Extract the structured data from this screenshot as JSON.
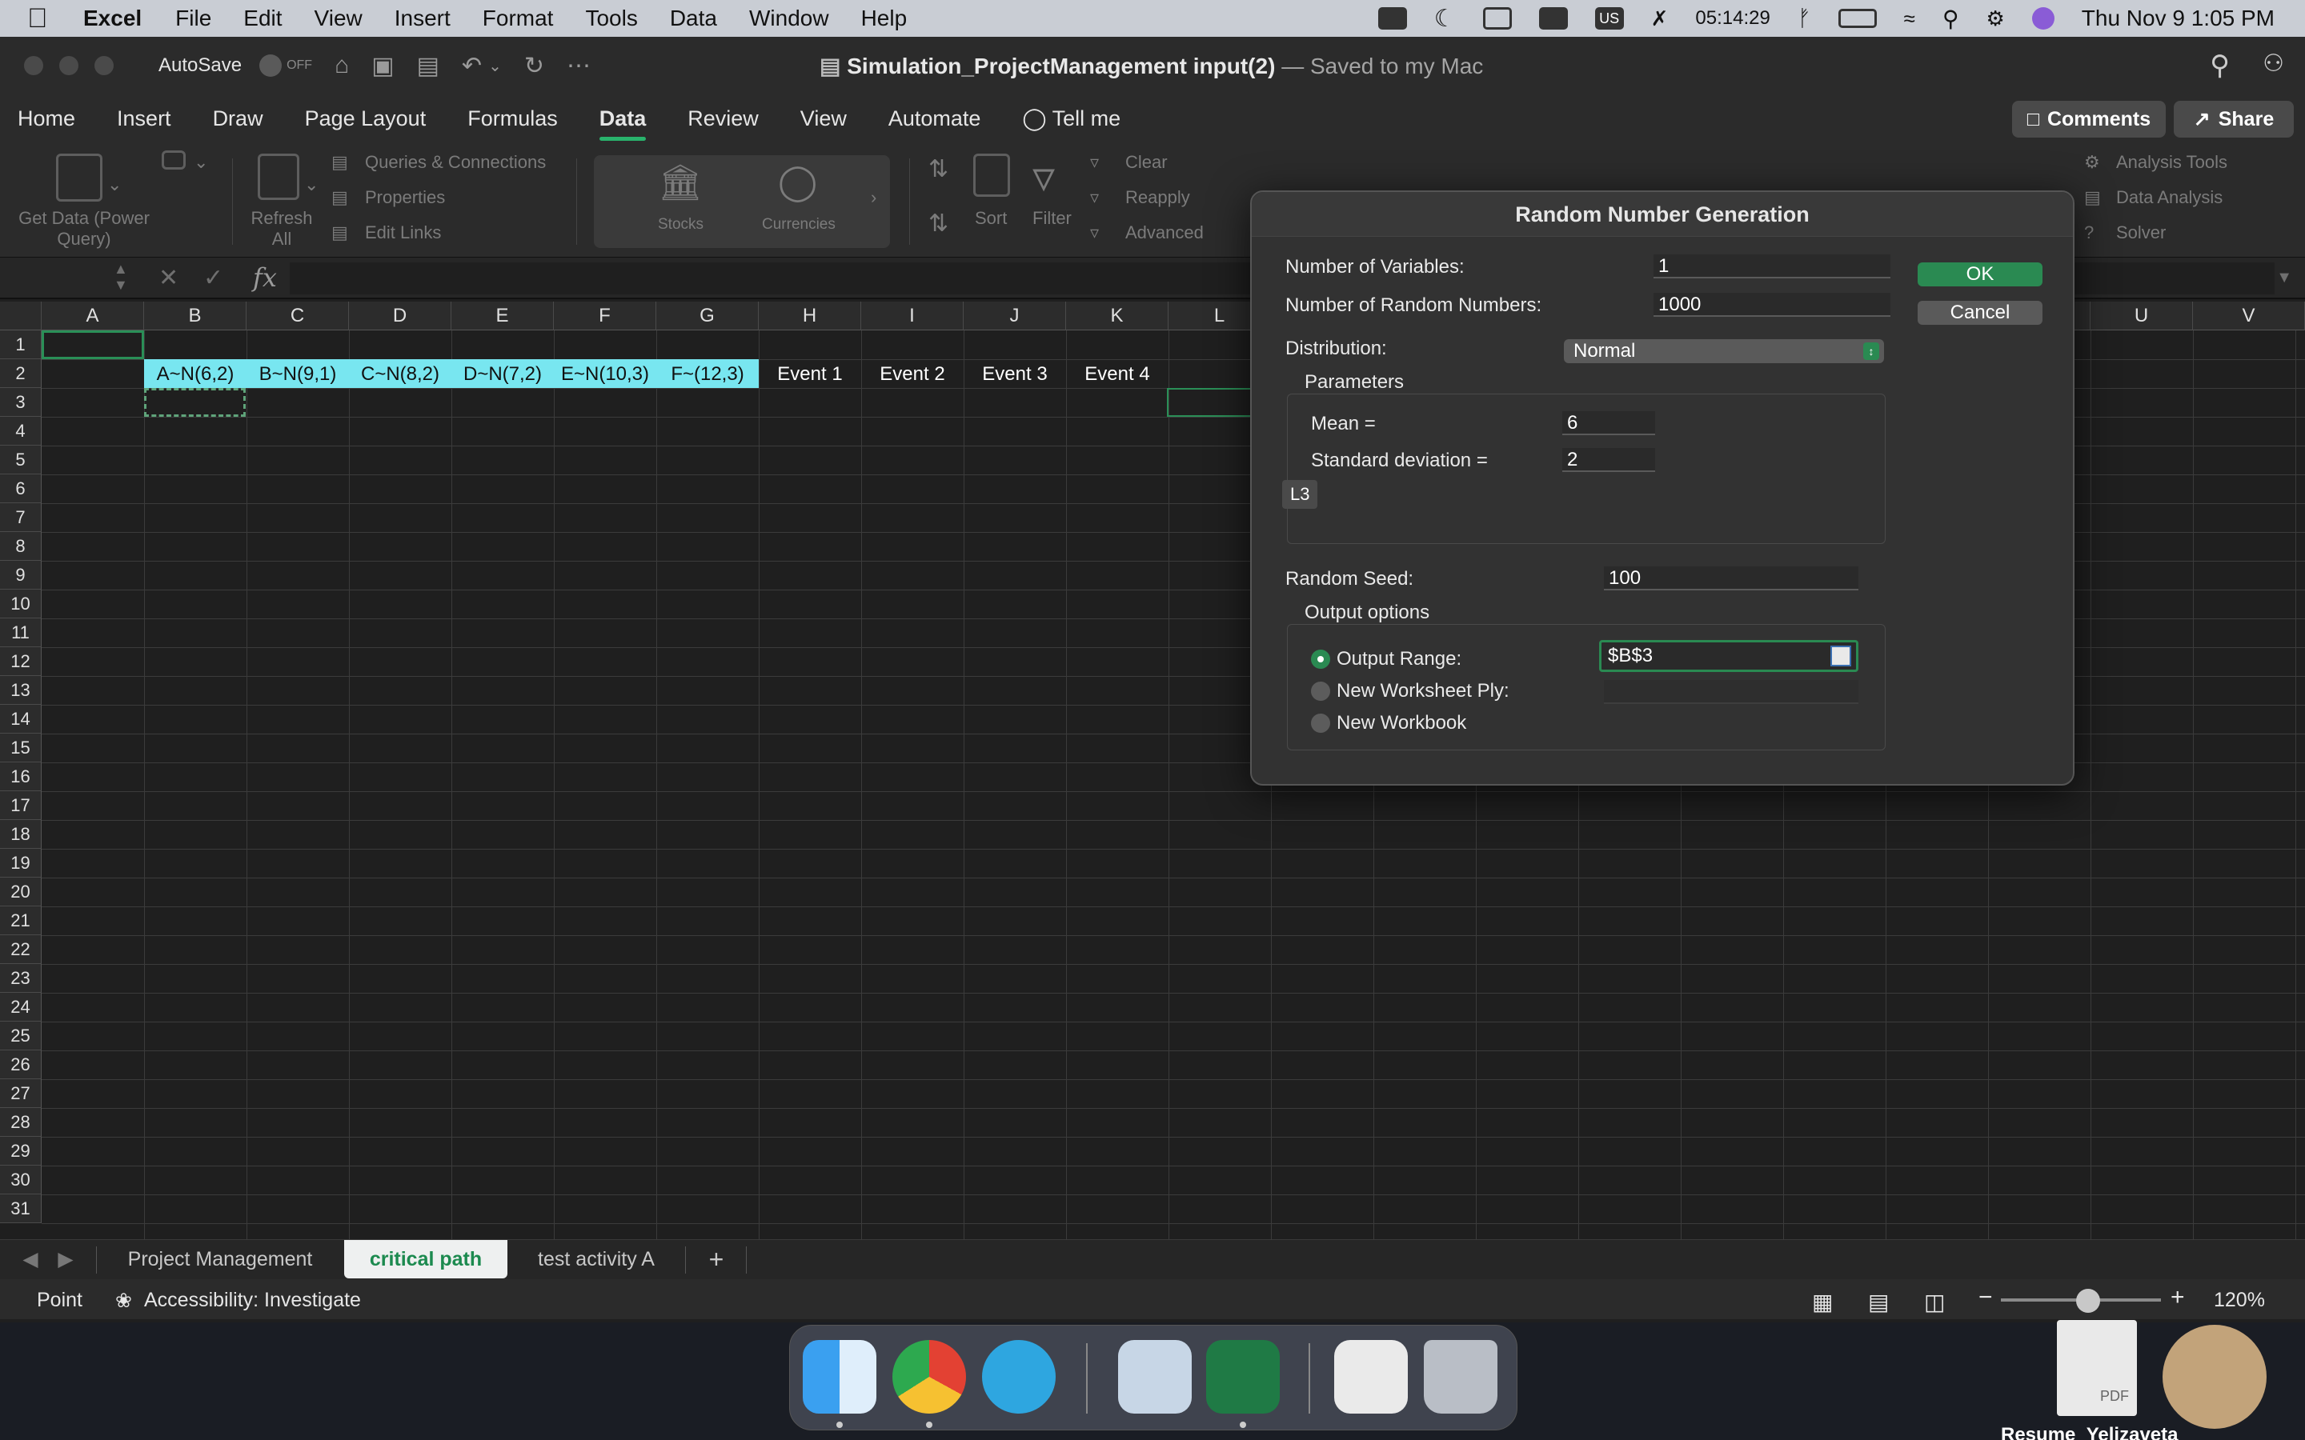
{
  "menubar": {
    "app_name": "Excel",
    "items": [
      "File",
      "Edit",
      "View",
      "Insert",
      "Format",
      "Tools",
      "Data",
      "Window",
      "Help"
    ],
    "timer": "05:14:29",
    "input_source": "US",
    "datetime": "Thu Nov 9  1:05 PM"
  },
  "titlebar": {
    "autosave_label": "AutoSave",
    "autosave_state": "OFF",
    "doc_name": "Simulation_ProjectManagement input(2)",
    "saved_status": "— Saved to my Mac"
  },
  "ribbon_tabs": [
    "Home",
    "Insert",
    "Draw",
    "Page Layout",
    "Formulas",
    "Data",
    "Review",
    "View",
    "Automate"
  ],
  "active_tab": "Data",
  "tell_me": "Tell me",
  "comments_label": "Comments",
  "share_label": "Share",
  "ribbon": {
    "get_data_label": "Get Data (Power Query)",
    "refresh_all_label": "Refresh All",
    "queries_label": "Queries & Connections",
    "properties_label": "Properties",
    "edit_links_label": "Edit Links",
    "stocks_label": "Stocks",
    "currencies_label": "Currencies",
    "sort_label": "Sort",
    "filter_label": "Filter",
    "clear_label": "Clear",
    "reapply_label": "Reapply",
    "advanced_label": "Advanced",
    "analysis_tools_label": "Analysis Tools",
    "data_analysis_label": "Data Analysis",
    "solver_label": "Solver"
  },
  "formula_bar": {
    "fx": "fx",
    "value": ""
  },
  "grid": {
    "columns": [
      "A",
      "B",
      "C",
      "D",
      "E",
      "F",
      "G",
      "H",
      "I",
      "J",
      "K",
      "L",
      "M",
      "N",
      "O",
      "P",
      "Q",
      "R",
      "S",
      "T",
      "U",
      "V"
    ],
    "rows": [
      "1",
      "2",
      "3",
      "4",
      "5",
      "6",
      "7",
      "8",
      "9",
      "10",
      "11",
      "12",
      "13",
      "14",
      "15",
      "16",
      "17",
      "18",
      "19",
      "20",
      "21",
      "22",
      "23",
      "24",
      "25",
      "26",
      "27",
      "28",
      "29",
      "30",
      "31"
    ],
    "row2": {
      "B": "A~N(6,2)",
      "C": "B~N(9,1)",
      "D": "C~N(8,2)",
      "E": "D~N(7,2)",
      "F": "E~N(10,3)",
      "G": "F~(12,3)",
      "H": "Event  1",
      "I": "Event  2",
      "J": "Event  3",
      "K": "Event  4"
    },
    "highlight_color": "#78E6F0"
  },
  "dialog": {
    "title": "Random Number Generation",
    "num_variables_label": "Number of Variables:",
    "num_variables_value": "1",
    "num_random_label": "Number of Random Numbers:",
    "num_random_value": "1000",
    "distribution_label": "Distribution:",
    "distribution_value": "Normal",
    "parameters_label": "Parameters",
    "mean_label": "Mean =",
    "mean_value": "6",
    "std_label": "Standard deviation =",
    "std_value": "2",
    "cell_tip": "L3",
    "seed_label": "Random Seed:",
    "seed_value": "100",
    "output_options_label": "Output options",
    "output_range_label": "Output Range:",
    "output_range_value": "$B$3",
    "new_ply_label": "New Worksheet Ply:",
    "new_workbook_label": "New Workbook",
    "selected_output": "Output Range:",
    "ok_label": "OK",
    "cancel_label": "Cancel",
    "accent_color": "#2A8A52"
  },
  "sheets": [
    "Project Management",
    "critical path",
    "test activity A"
  ],
  "active_sheet": "critical path",
  "statusbar": {
    "mode": "Point",
    "accessibility": "Accessibility: Investigate",
    "zoom": "120%"
  },
  "desktop": {
    "file_label": "Resume_Yelizaveta",
    "pdf_badge": "PDF"
  }
}
